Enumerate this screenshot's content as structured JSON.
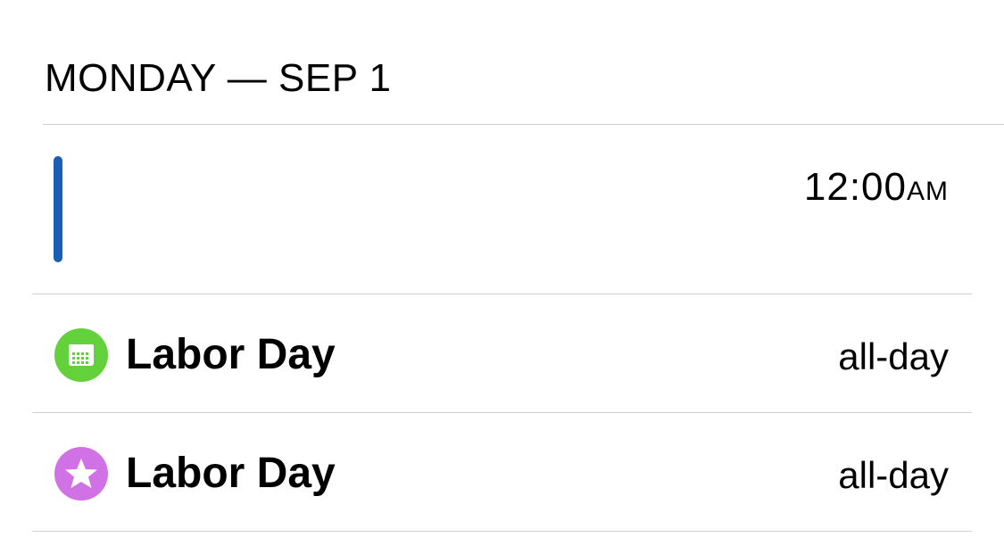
{
  "section": {
    "header": "MONDAY — SEP 1"
  },
  "time_entry": {
    "time": "12:00",
    "ampm": "AM",
    "bar_color": "#1a5fb4"
  },
  "events": [
    {
      "title": "Labor Day",
      "time": "all-day",
      "icon": "calendar-icon",
      "icon_color": "#62d13c"
    },
    {
      "title": "Labor Day",
      "time": "all-day",
      "icon": "star-icon",
      "icon_color": "#d171e6"
    }
  ],
  "colors": {
    "divider": "#cfcfd3",
    "text": "#000000",
    "background": "#ffffff"
  }
}
